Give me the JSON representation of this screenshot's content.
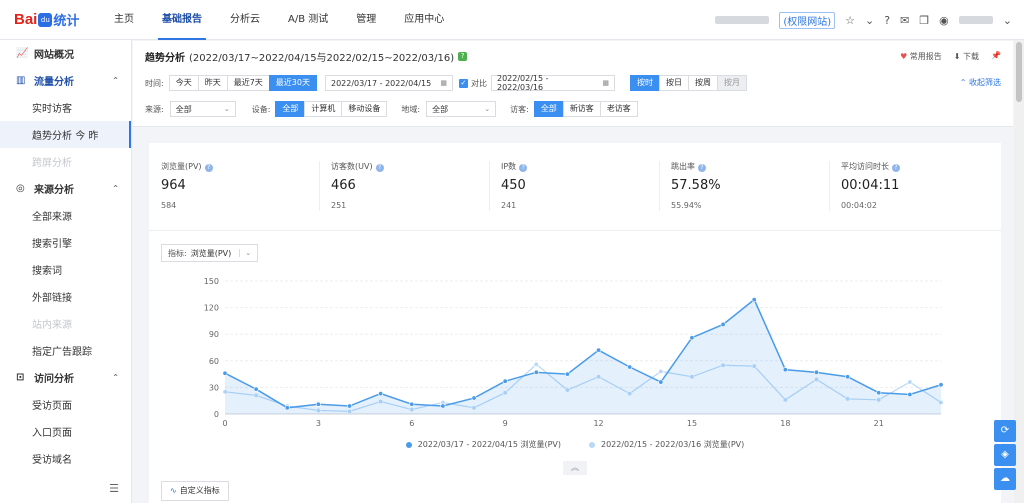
{
  "brand": {
    "name_red": "Bai",
    "paw": "du",
    "name_blue": "统计"
  },
  "nav": [
    {
      "label": "主页",
      "active": false
    },
    {
      "label": "基础报告",
      "active": true
    },
    {
      "label": "分析云",
      "active": false
    },
    {
      "label": "A/B 测试",
      "active": false
    },
    {
      "label": "管理",
      "active": false
    },
    {
      "label": "应用中心",
      "active": false
    }
  ],
  "topright": {
    "site_tag": "(权限网站)"
  },
  "sidebar": {
    "overview": "网站概况",
    "flow": {
      "label": "流量分析",
      "items": [
        "实时访客",
        "趋势分析",
        "跨屏分析"
      ],
      "trend_suffix": "今  昨"
    },
    "source": {
      "label": "来源分析",
      "items": [
        "全部来源",
        "搜索引擎",
        "搜索词",
        "外部链接",
        "站内来源",
        "指定广告跟踪"
      ]
    },
    "visit": {
      "label": "访问分析",
      "items": [
        "受访页面",
        "入口页面",
        "受访域名"
      ]
    }
  },
  "header": {
    "title": "趋势分析",
    "range": "(2022/03/17~2022/04/15与2022/02/15~2022/03/16)",
    "fav": "常用报告",
    "download": "下载",
    "collapse": "收起筛选"
  },
  "filters": {
    "time_label": "时间:",
    "time_btns": [
      "今天",
      "昨天",
      "最近7天",
      "最近30天"
    ],
    "date1": "2022/03/17 - 2022/04/15",
    "compare_label": "对比",
    "date2": "2022/02/15 - 2022/03/16",
    "gran_btns": [
      "按时",
      "按日",
      "按周",
      "按月"
    ],
    "source_label": "来源:",
    "source_val": "全部",
    "device_label": "设备:",
    "device_btns": [
      "全部",
      "计算机",
      "移动设备"
    ],
    "region_label": "地域:",
    "region_val": "全部",
    "visitor_label": "访客:",
    "visitor_btns": [
      "全部",
      "新访客",
      "老访客"
    ]
  },
  "kpis": [
    {
      "label": "浏览量(PV)",
      "value": "964",
      "compare": "584"
    },
    {
      "label": "访客数(UV)",
      "value": "466",
      "compare": "251"
    },
    {
      "label": "IP数",
      "value": "450",
      "compare": "241"
    },
    {
      "label": "跳出率",
      "value": "57.58%",
      "compare": "55.94%"
    },
    {
      "label": "平均访问时长",
      "value": "00:04:11",
      "compare": "00:04:02"
    }
  ],
  "metric": {
    "label": "指标:",
    "value": "浏览量(PV)"
  },
  "custom_btn": "自定义指标",
  "chart_data": {
    "type": "area",
    "x": [
      0,
      1,
      2,
      3,
      4,
      5,
      6,
      7,
      8,
      9,
      10,
      11,
      12,
      13,
      14,
      15,
      16,
      17,
      18,
      19,
      20,
      21,
      22,
      23
    ],
    "xticks": [
      "0",
      "3",
      "6",
      "9",
      "12",
      "15",
      "18",
      "21"
    ],
    "yticks": [
      "0",
      "30",
      "60",
      "90",
      "120",
      "150"
    ],
    "ylim": [
      0,
      150
    ],
    "series": [
      {
        "name": "2022/03/17 - 2022/04/15 浏览量(PV)",
        "color": "#4a9be8",
        "values": [
          46,
          28,
          7,
          11,
          9,
          23,
          11,
          9,
          18,
          37,
          47,
          45,
          72,
          53,
          36,
          86,
          101,
          129,
          50,
          47,
          42,
          24,
          22,
          33
        ]
      },
      {
        "name": "2022/02/15 - 2022/03/16 浏览量(PV)",
        "color": "#b8d8f6",
        "values": [
          25,
          21,
          9,
          4,
          3,
          14,
          5,
          13,
          7,
          24,
          56,
          27,
          42,
          23,
          48,
          42,
          55,
          54,
          16,
          39,
          17,
          16,
          36,
          13
        ]
      }
    ]
  }
}
